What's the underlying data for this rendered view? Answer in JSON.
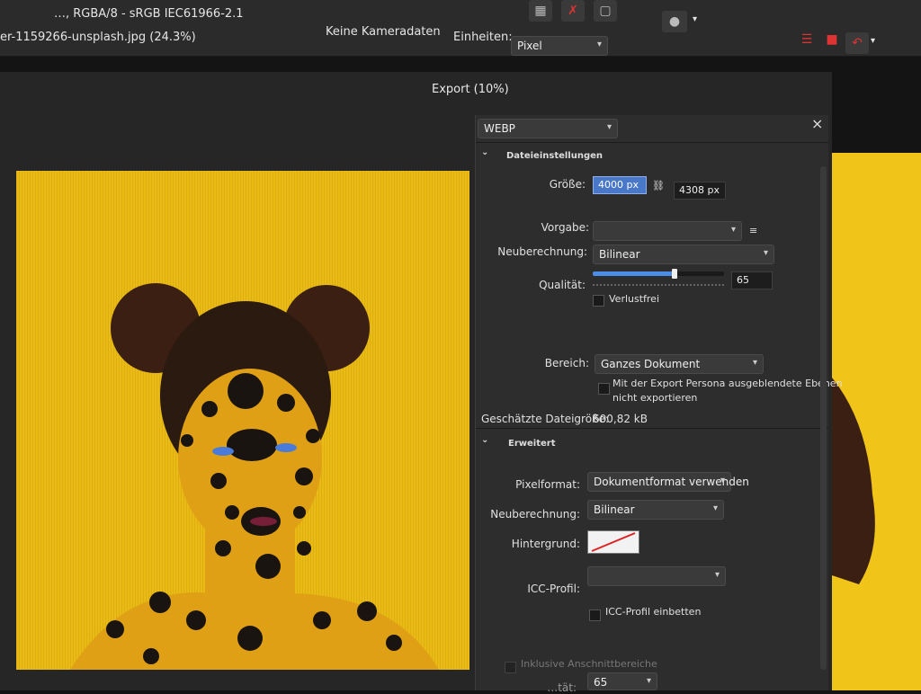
{
  "topbar": {
    "colorspace": "…, RGBA/8 - sRGB IEC61966-2.1",
    "camera": "Keine Kameradaten",
    "units_label": "Einheiten:",
    "units_value": "Pixel",
    "filename": "er-1159266-unsplash.jpg (24.3%)"
  },
  "dialog": {
    "title": "Export (10%)",
    "format": "WEBP",
    "close": "×"
  },
  "file_settings": {
    "header": "Dateieinstellungen",
    "size_label": "Größe:",
    "width": "4000 px",
    "height": "4308 px",
    "preset_label": "Vorgabe:",
    "preset_value": "",
    "resample_label": "Neuberechnung:",
    "resample_value": "Bilinear",
    "quality_label": "Qualität:",
    "quality_value": "65",
    "quality_percent": 62,
    "lossless_label": "Verlustfrei",
    "area_label": "Bereich:",
    "area_value": "Ganzes Dokument",
    "hidden_layers_line1": "Mit der Export Persona ausgeblendete Ebenen",
    "hidden_layers_line2": "nicht exportieren",
    "estimated_label": "Geschätzte Dateigröße:",
    "estimated_value": "600,82 kB"
  },
  "advanced": {
    "header": "Erweitert",
    "pixelformat_label": "Pixelformat:",
    "pixelformat_value": "Dokumentformat verwenden",
    "resample_label": "Neuberechnung:",
    "resample_value": "Bilinear",
    "background_label": "Hintergrund:",
    "icc_label": "ICC-Profil:",
    "icc_value": "",
    "icc_embed_label": "ICC-Profil einbetten",
    "bleed_label": "Inklusive Anschnittbereiche",
    "bottom_label": "…tät:",
    "bottom_value": "65"
  }
}
